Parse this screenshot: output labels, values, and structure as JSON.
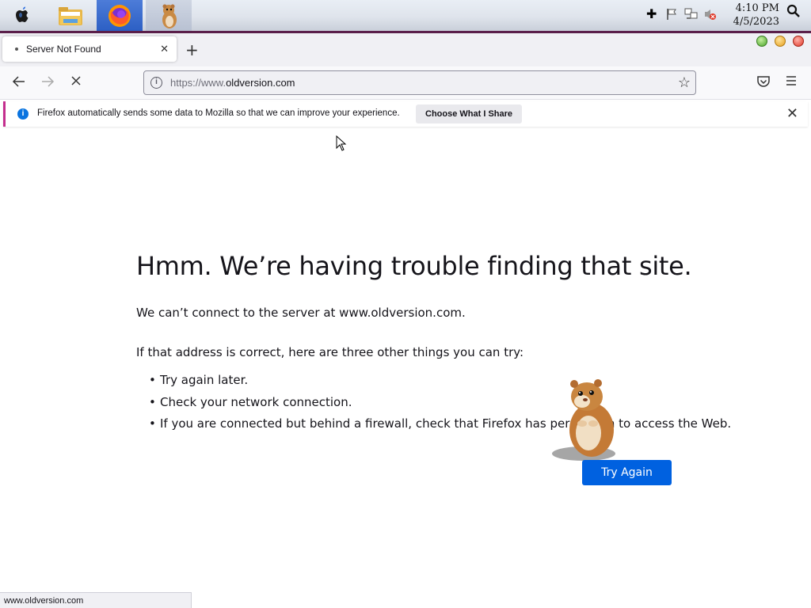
{
  "os_bar": {
    "clock_time": "4:10 PM",
    "clock_date": "4/5/2023"
  },
  "browser": {
    "tab_title": "Server Not Found",
    "url_prefix": "https://www.",
    "url_domain": "oldversion.com",
    "notification": {
      "message": "Firefox automatically sends some data to Mozilla so that we can improve your experience.",
      "button_label": "Choose What I Share"
    },
    "status_text": "www.oldversion.com"
  },
  "error_page": {
    "title": "Hmm. We’re having trouble finding that site.",
    "description": "We can’t connect to the server at www.oldversion.com.",
    "intro": "If that address is correct, here are three other things you can try:",
    "suggestions": [
      "Try again later.",
      "Check your network connection.",
      "If you are connected but behind a firewall, check that Firefox has permission to access the Web."
    ],
    "try_again_label": "Try Again"
  },
  "colors": {
    "accent_button": "#0061e0",
    "notification_stripe": "#c42e8e",
    "info_icon": "#0a74e0"
  },
  "icons": [
    "apple-icon",
    "file-manager-icon",
    "firefox-icon",
    "hamster-icon",
    "plus-icon",
    "flag-icon",
    "network-icon",
    "volume-muted-icon",
    "search-icon",
    "back-icon",
    "forward-icon",
    "stop-icon",
    "info-icon",
    "star-icon",
    "pocket-icon",
    "menu-icon",
    "close-icon"
  ]
}
